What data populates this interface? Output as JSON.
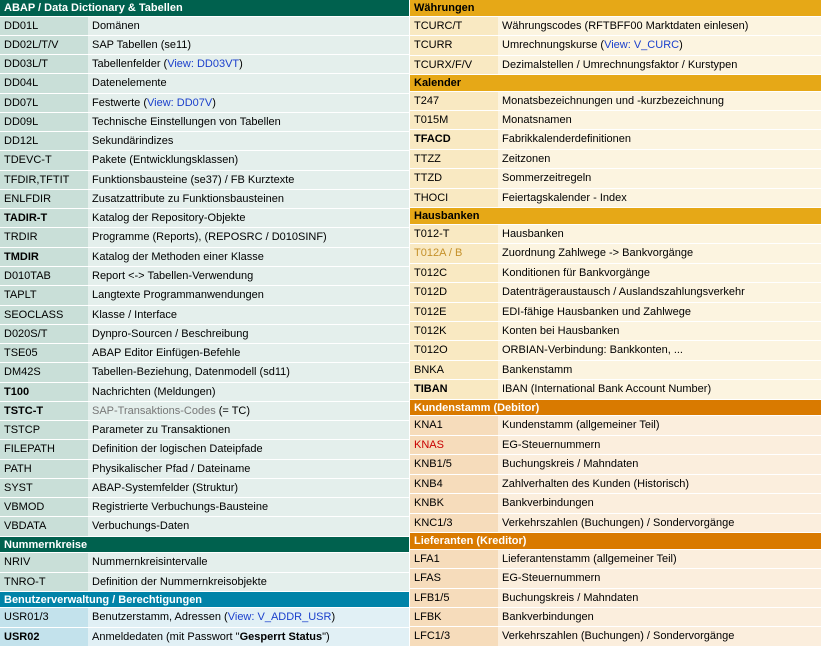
{
  "left": [
    {
      "type": "header",
      "style": "green",
      "text": "ABAP / Data Dictionary & Tabellen"
    },
    {
      "type": "row",
      "tint": "green",
      "code": "DD01L",
      "parts": [
        {
          "t": "Domänen"
        }
      ]
    },
    {
      "type": "row",
      "tint": "green",
      "code": "DD02L/T/V",
      "parts": [
        {
          "t": "SAP Tabellen (se11)"
        }
      ]
    },
    {
      "type": "row",
      "tint": "green",
      "code": "DD03L/T",
      "parts": [
        {
          "t": "Tabellenfelder ("
        },
        {
          "t": "View: DD03VT",
          "cls": "link"
        },
        {
          "t": ")"
        }
      ]
    },
    {
      "type": "row",
      "tint": "green",
      "code": "DD04L",
      "parts": [
        {
          "t": "Datenelemente"
        }
      ]
    },
    {
      "type": "row",
      "tint": "green",
      "code": "DD07L",
      "parts": [
        {
          "t": "Festwerte ("
        },
        {
          "t": "View: DD07V",
          "cls": "link"
        },
        {
          "t": ")"
        }
      ]
    },
    {
      "type": "row",
      "tint": "green",
      "code": "DD09L",
      "parts": [
        {
          "t": "Technische Einstellungen von Tabellen"
        }
      ]
    },
    {
      "type": "row",
      "tint": "green",
      "code": "DD12L",
      "parts": [
        {
          "t": "Sekundärindizes"
        }
      ]
    },
    {
      "type": "row",
      "tint": "green",
      "code": "TDEVC-T",
      "parts": [
        {
          "t": "Pakete (Entwicklungsklassen)"
        }
      ]
    },
    {
      "type": "row",
      "tint": "green",
      "code": "TFDIR,TFTIT",
      "parts": [
        {
          "t": "Funktionsbausteine (se37) / FB Kurztexte"
        }
      ]
    },
    {
      "type": "row",
      "tint": "green",
      "code": "ENLFDIR",
      "parts": [
        {
          "t": "Zusatzattribute zu Funktionsbausteinen"
        }
      ]
    },
    {
      "type": "row",
      "tint": "green",
      "code": "TADIR-T",
      "codeBold": true,
      "parts": [
        {
          "t": "Katalog der Repository-Objekte"
        }
      ]
    },
    {
      "type": "row",
      "tint": "green",
      "code": "TRDIR",
      "parts": [
        {
          "t": "Programme (Reports), (REPOSRC / D010SINF)"
        }
      ]
    },
    {
      "type": "row",
      "tint": "green",
      "code": "TMDIR",
      "codeBold": true,
      "parts": [
        {
          "t": "Katalog der Methoden einer Klasse"
        }
      ]
    },
    {
      "type": "row",
      "tint": "green",
      "code": "D010TAB",
      "parts": [
        {
          "t": "Report <-> Tabellen-Verwendung"
        }
      ]
    },
    {
      "type": "row",
      "tint": "green",
      "code": "TAPLT",
      "parts": [
        {
          "t": "Langtexte Programmanwendungen"
        }
      ]
    },
    {
      "type": "row",
      "tint": "green",
      "code": "SEOCLASS",
      "parts": [
        {
          "t": "Klasse / Interface"
        }
      ]
    },
    {
      "type": "row",
      "tint": "green",
      "code": "D020S/T",
      "parts": [
        {
          "t": "Dynpro-Sourcen / Beschreibung"
        }
      ]
    },
    {
      "type": "row",
      "tint": "green",
      "code": "TSE05",
      "parts": [
        {
          "t": "ABAP Editor Einfügen-Befehle"
        }
      ]
    },
    {
      "type": "row",
      "tint": "green",
      "code": "DM42S",
      "parts": [
        {
          "t": "Tabellen-Beziehung, Datenmodell (sd11)"
        }
      ]
    },
    {
      "type": "row",
      "tint": "green",
      "code": "T100",
      "codeBold": true,
      "parts": [
        {
          "t": "Nachrichten (Meldungen)"
        }
      ]
    },
    {
      "type": "row",
      "tint": "green",
      "code": "TSTC-T",
      "codeBold": true,
      "parts": [
        {
          "t": "SAP-Transaktions-Codes",
          "cls": "grey"
        },
        {
          "t": " (= TC)"
        }
      ]
    },
    {
      "type": "row",
      "tint": "green",
      "code": "TSTCP",
      "parts": [
        {
          "t": "Parameter zu Transaktionen"
        }
      ]
    },
    {
      "type": "row",
      "tint": "green",
      "code": "FILEPATH",
      "parts": [
        {
          "t": "Definition der logischen Dateipfade"
        }
      ]
    },
    {
      "type": "row",
      "tint": "green",
      "code": "PATH",
      "parts": [
        {
          "t": "Physikalischer Pfad / Dateiname"
        }
      ]
    },
    {
      "type": "row",
      "tint": "green",
      "code": "SYST",
      "parts": [
        {
          "t": "ABAP-Systemfelder (Struktur)"
        }
      ]
    },
    {
      "type": "row",
      "tint": "green",
      "code": "VBMOD",
      "parts": [
        {
          "t": "Registrierte Verbuchungs-Bausteine"
        }
      ]
    },
    {
      "type": "row",
      "tint": "green",
      "code": "VBDATA",
      "parts": [
        {
          "t": "Verbuchungs-Daten"
        }
      ]
    },
    {
      "type": "header",
      "style": "green",
      "text": "Nummernkreise"
    },
    {
      "type": "row",
      "tint": "green",
      "code": "NRIV",
      "parts": [
        {
          "t": "Nummernkreisintervalle"
        }
      ]
    },
    {
      "type": "row",
      "tint": "green",
      "code": "TNRO-T",
      "parts": [
        {
          "t": "Definition der Nummernkreisobjekte"
        }
      ]
    },
    {
      "type": "header",
      "style": "teal",
      "text": "Benutzerverwaltung / Berechtigungen"
    },
    {
      "type": "row",
      "tint": "teal",
      "code": "USR01/3",
      "parts": [
        {
          "t": "Benutzerstamm, Adressen ("
        },
        {
          "t": "View: ",
          "cls": "link"
        },
        {
          "t": "V_ADDR_USR",
          "cls": "link"
        },
        {
          "t": ")"
        }
      ]
    },
    {
      "type": "row",
      "tint": "teal",
      "code": "USR02",
      "codeBold": true,
      "parts": [
        {
          "t": "Anmeldedaten (mit Passwort \""
        },
        {
          "t": "Gesperrt Status",
          "cls": "bold"
        },
        {
          "t": "\")"
        }
      ]
    }
  ],
  "right": [
    {
      "type": "header",
      "style": "gold",
      "text": "Währungen"
    },
    {
      "type": "row",
      "tint": "gold",
      "code": "TCURC/T",
      "parts": [
        {
          "t": "Währungscodes (RFTBFF00 Marktdaten einlesen)"
        }
      ]
    },
    {
      "type": "row",
      "tint": "gold",
      "code": "TCURR",
      "parts": [
        {
          "t": "Umrechnungskurse ("
        },
        {
          "t": "View: V_CURC",
          "cls": "link"
        },
        {
          "t": ")"
        }
      ]
    },
    {
      "type": "row",
      "tint": "gold",
      "code": "TCURX/F/V",
      "parts": [
        {
          "t": "Dezimalstellen / Umrechnungsfaktor / Kurstypen"
        }
      ]
    },
    {
      "type": "header",
      "style": "gold",
      "text": "Kalender"
    },
    {
      "type": "row",
      "tint": "gold",
      "code": "T247",
      "parts": [
        {
          "t": "Monatsbezeichnungen und -kurzbezeichnung"
        }
      ]
    },
    {
      "type": "row",
      "tint": "gold",
      "code": "T015M",
      "parts": [
        {
          "t": "Monatsnamen"
        }
      ]
    },
    {
      "type": "row",
      "tint": "gold",
      "code": "TFACD",
      "codeBold": true,
      "parts": [
        {
          "t": "Fabrikkalenderdefinitionen"
        }
      ]
    },
    {
      "type": "row",
      "tint": "gold",
      "code": "TTZZ",
      "parts": [
        {
          "t": "Zeitzonen"
        }
      ]
    },
    {
      "type": "row",
      "tint": "gold",
      "code": "TTZD",
      "parts": [
        {
          "t": "Sommerzeitregeln"
        }
      ]
    },
    {
      "type": "row",
      "tint": "gold",
      "code": "THOCI",
      "parts": [
        {
          "t": "Feiertagskalender - Index"
        }
      ]
    },
    {
      "type": "header",
      "style": "gold",
      "text": "Hausbanken"
    },
    {
      "type": "row",
      "tint": "gold",
      "code": "T012-T",
      "parts": [
        {
          "t": "Hausbanken"
        }
      ]
    },
    {
      "type": "row",
      "tint": "gold",
      "code": "T012A / B",
      "codeCls": "gold",
      "parts": [
        {
          "t": "Zuordnung Zahlwege -> Bankvorgänge"
        }
      ]
    },
    {
      "type": "row",
      "tint": "gold",
      "code": "T012C",
      "parts": [
        {
          "t": "Konditionen für Bankvorgänge"
        }
      ]
    },
    {
      "type": "row",
      "tint": "gold",
      "code": "T012D",
      "parts": [
        {
          "t": "Datenträgeraustausch / Auslandszahlungsverkehr"
        }
      ]
    },
    {
      "type": "row",
      "tint": "gold",
      "code": "T012E",
      "parts": [
        {
          "t": "EDI-fähige Hausbanken und Zahlwege"
        }
      ]
    },
    {
      "type": "row",
      "tint": "gold",
      "code": "T012K",
      "parts": [
        {
          "t": "Konten bei Hausbanken"
        }
      ]
    },
    {
      "type": "row",
      "tint": "gold",
      "code": "T012O",
      "parts": [
        {
          "t": "ORBIAN-Verbindung: Bankkonten, ..."
        }
      ]
    },
    {
      "type": "row",
      "tint": "gold",
      "code": "BNKA",
      "parts": [
        {
          "t": "Bankenstamm"
        }
      ]
    },
    {
      "type": "row",
      "tint": "gold",
      "code": "TIBAN",
      "codeBold": true,
      "parts": [
        {
          "t": "IBAN (International Bank Account Number)"
        }
      ]
    },
    {
      "type": "header",
      "style": "orange",
      "text": "Kundenstamm (Debitor)"
    },
    {
      "type": "row",
      "tint": "orange",
      "code": "KNA1",
      "parts": [
        {
          "t": "Kundenstamm (allgemeiner Teil)"
        }
      ]
    },
    {
      "type": "row",
      "tint": "orange",
      "code": "KNAS",
      "codeCls": "red",
      "parts": [
        {
          "t": "EG-Steuernummern"
        }
      ]
    },
    {
      "type": "row",
      "tint": "orange",
      "code": "KNB1/5",
      "parts": [
        {
          "t": "Buchungskreis / Mahndaten"
        }
      ]
    },
    {
      "type": "row",
      "tint": "orange",
      "code": "KNB4",
      "parts": [
        {
          "t": "Zahlverhalten des Kunden (Historisch)"
        }
      ]
    },
    {
      "type": "row",
      "tint": "orange",
      "code": "KNBK",
      "parts": [
        {
          "t": "Bankverbindungen"
        }
      ]
    },
    {
      "type": "row",
      "tint": "orange",
      "code": "KNC1/3",
      "parts": [
        {
          "t": "Verkehrszahlen (Buchungen) / Sondervorgänge"
        }
      ]
    },
    {
      "type": "header",
      "style": "orange",
      "text": "Lieferanten (Kreditor)"
    },
    {
      "type": "row",
      "tint": "orange",
      "code": "LFA1",
      "parts": [
        {
          "t": "Lieferantenstamm (allgemeiner Teil)"
        }
      ]
    },
    {
      "type": "row",
      "tint": "orange",
      "code": "LFAS",
      "parts": [
        {
          "t": "EG-Steuernummern"
        }
      ]
    },
    {
      "type": "row",
      "tint": "orange",
      "code": "LFB1/5",
      "parts": [
        {
          "t": "Buchungskreis / Mahndaten"
        }
      ]
    },
    {
      "type": "row",
      "tint": "orange",
      "code": "LFBK",
      "parts": [
        {
          "t": "Bankverbindungen"
        }
      ]
    },
    {
      "type": "row",
      "tint": "orange",
      "code": "LFC1/3",
      "parts": [
        {
          "t": "Verkehrszahlen (Buchungen) / Sondervorgänge"
        }
      ]
    }
  ]
}
